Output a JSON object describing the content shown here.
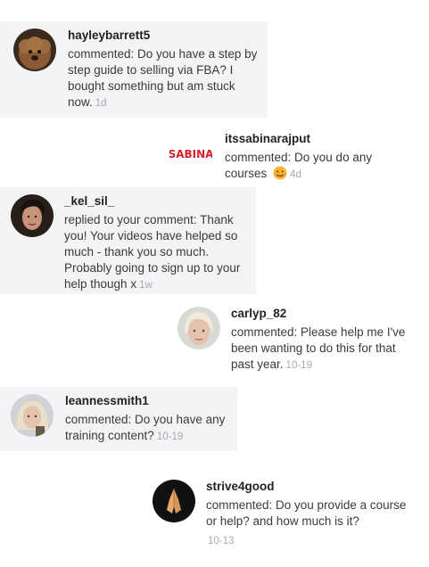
{
  "notifications": [
    {
      "username": "hayleybarrett5",
      "text": "commented: Do you have a step by step guide to selling via FBA? I bought something but am stuck now.",
      "time": "1d",
      "avatar_icon": "dog-avatar-icon"
    },
    {
      "username": "itssabinarajput",
      "text": "commented: Do you do any courses",
      "time": "4d",
      "avatar_icon": "sabina-logo-icon",
      "avatar_logo_text": "SABINA",
      "emoji": "smiling-face-icon"
    },
    {
      "username": "_kel_sil_",
      "text": "replied to your comment: Thank you! Your videos have helped so much - thank you so much. Probably going to sign up to your help though x",
      "time": "1w",
      "avatar_icon": "woman-avatar-icon"
    },
    {
      "username": "carlyp_82",
      "text": "commented: Please help me I've been wanting to do this for that past year.",
      "time": "10-19",
      "avatar_icon": "blonde-woman-avatar-icon"
    },
    {
      "username": "leannessmith1",
      "text": "commented: Do you have any training content?",
      "time": "10-19",
      "avatar_icon": "woman-selfie-avatar-icon"
    },
    {
      "username": "strive4good",
      "text": "commented: Do you provide a course or help? and how much is it?",
      "time": "10-13",
      "avatar_icon": "praying-hands-avatar-icon"
    }
  ],
  "colors": {
    "card_background": "#f4f4f6",
    "timestamp": "#a8a8ae",
    "username": "#222222",
    "logo_red": "#d81e2a"
  }
}
